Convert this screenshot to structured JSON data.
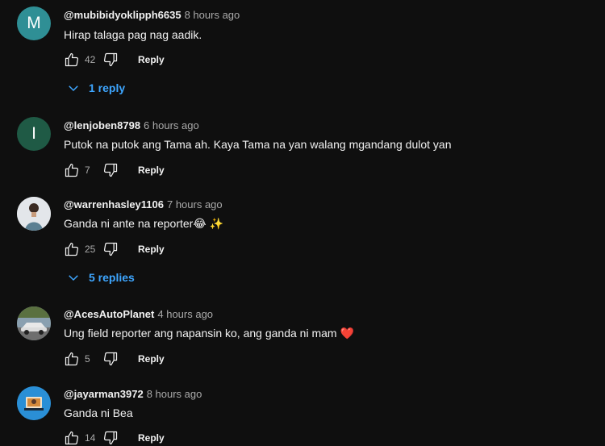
{
  "comments": [
    {
      "author": "@mubibidyoklipph6635",
      "time": "8 hours ago",
      "text": "Hirap talaga pag nag aadik.",
      "likes": "42",
      "reply_label": "Reply",
      "avatar_letter": "M",
      "avatar_color": "#2f8f95",
      "replies_label": "1 reply"
    },
    {
      "author": "@lenjoben8798",
      "time": "6 hours ago",
      "text": "Putok na putok ang Tama ah. Kaya Tama na yan walang mgandang dulot yan",
      "likes": "7",
      "reply_label": "Reply",
      "avatar_letter": "I",
      "avatar_color": "#1f5a45"
    },
    {
      "author": "@warrenhasley1106",
      "time": "7 hours ago",
      "text": "Ganda ni ante na reporter😂 ✨",
      "likes": "25",
      "reply_label": "Reply",
      "replies_label": "5 replies"
    },
    {
      "author": "@AcesAutoPlanet",
      "time": "4 hours ago",
      "text": "Ung field reporter ang napansin ko, ang ganda ni mam ❤️",
      "likes": "5",
      "reply_label": "Reply"
    },
    {
      "author": "@jayarman3972",
      "time": "8 hours ago",
      "text": "Ganda ni Bea",
      "likes": "14",
      "reply_label": "Reply"
    }
  ],
  "colors": {
    "link": "#3ea6ff",
    "secondary_text": "#aaaaaa",
    "background": "#0f0f0f"
  },
  "icons": [
    "thumbs-up-icon",
    "thumbs-down-icon",
    "chevron-down-icon"
  ]
}
